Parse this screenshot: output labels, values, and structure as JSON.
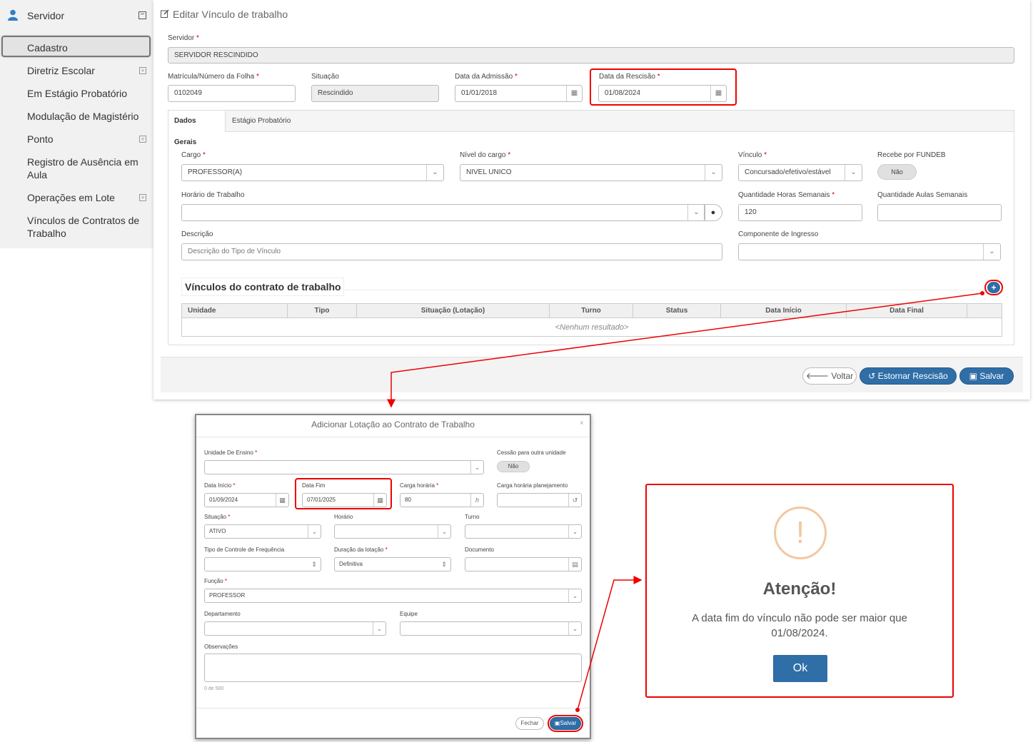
{
  "sidebar": {
    "title": "Servidor",
    "items": [
      {
        "label": "Cadastro"
      },
      {
        "label": "Diretriz Escolar"
      },
      {
        "label": "Em Estágio Probatório"
      },
      {
        "label": "Modulação de Magistério"
      },
      {
        "label": "Ponto"
      },
      {
        "label": "Registro de Ausência em Aula"
      },
      {
        "label": "Operações em Lote"
      },
      {
        "label": "Vínculos de Contratos de Trabalho"
      }
    ]
  },
  "main": {
    "title": "Editar Vínculo de trabalho",
    "servidor_label": "Servidor",
    "servidor_value": "SERVIDOR RESCINDIDO",
    "matricula_label": "Matrícula/Número da Folha",
    "matricula_value": "0102049",
    "situacao_label": "Situação",
    "situacao_value": "Rescindido",
    "admissao_label": "Data da Admissão",
    "admissao_value": "01/01/2018",
    "rescisao_label": "Data da Rescisão",
    "rescisao_value": "01/08/2024",
    "tabs": [
      {
        "label": "Dados Gerais"
      },
      {
        "label": "Estágio Probatório"
      }
    ],
    "cargo_label": "Cargo",
    "cargo_value": "PROFESSOR(A)",
    "nivel_label": "Nível do cargo",
    "nivel_value": "NIVEL UNICO",
    "vinculo_label": "Vínculo",
    "vinculo_value": "Concursado/efetivo/estável",
    "fundeb_label": "Recebe por FUNDEB",
    "fundeb_value": "Não",
    "horario_label": "Horário de Trabalho",
    "horas_label": "Quantidade Horas Semanais",
    "horas_value": "120",
    "aulas_label": "Quantidade Aulas Semanais",
    "descricao_label": "Descrição",
    "descricao_placeholder": "Descrição do Tipo de Vínculo",
    "componente_label": "Componente de Ingresso",
    "section_title": "Vínculos do contrato de trabalho",
    "columns": [
      "Unidade",
      "Tipo",
      "Situação (Lotação)",
      "Turno",
      "Status",
      "Data Início",
      "Data Final"
    ],
    "empty": "<Nenhum resultado>",
    "btn_voltar": "Voltar",
    "btn_estornar": "Estornar Rescisão",
    "btn_salvar": "Salvar"
  },
  "modal": {
    "title": "Adicionar Lotação ao Contrato de Trabalho",
    "unidade_label": "Unidade De Ensino",
    "cessao_label": "Cessão para outra unidade",
    "cessao_value": "Não",
    "inicio_label": "Data Início",
    "inicio_value": "01/09/2024",
    "fim_label": "Data Fim",
    "fim_value": "07/01/2025",
    "carga_label": "Carga horária",
    "carga_value": "80",
    "carga_unit": "h",
    "carga_plan_label": "Carga horária planejamento",
    "situacao_label": "Situação",
    "situacao_value": "ATIVO",
    "horario_label": "Horário",
    "turno_label": "Turno",
    "controle_label": "Tipo de Controle de Frequência",
    "duracao_label": "Duração da lotação",
    "duracao_value": "Definitiva",
    "documento_label": "Documento",
    "funcao_label": "Função",
    "funcao_value": "PROFESSOR",
    "departamento_label": "Departamento",
    "equipe_label": "Equipe",
    "obs_label": "Observações",
    "obs_count": "0 de 500",
    "btn_fechar": "Fechar",
    "btn_salvar": "Salvar"
  },
  "alert": {
    "title": "Atenção!",
    "message": "A data fim do vínculo não pode ser maior que 01/08/2024.",
    "ok": "Ok"
  },
  "colors": {
    "primary": "#2f6ea7",
    "highlight": "#e00000",
    "warning": "#f2c8a0"
  }
}
